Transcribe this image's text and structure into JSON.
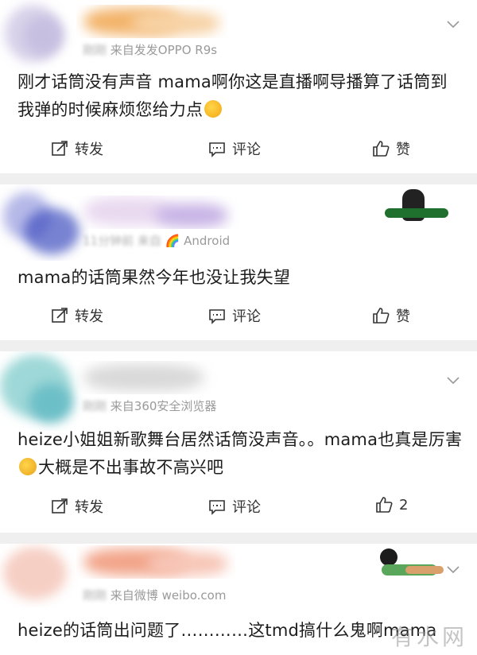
{
  "comments": [
    {
      "meta_prefix": "刚刚",
      "meta_visible": "来自发发OPPO R9s",
      "content_parts": [
        "刚才话筒没有声音  mama啊你这是直播啊导播算了话筒到我弹的时候麻烦您给力点",
        ""
      ],
      "actions": {
        "forward": "转发",
        "comment": "评论",
        "like": "赞"
      }
    },
    {
      "meta_prefix": "11分钟前",
      "meta_visible": "来自",
      "meta_visible2": "Android",
      "content_parts": [
        "mama的话筒果然今年也没让我失望"
      ],
      "actions": {
        "forward": "转发",
        "comment": "评论",
        "like": "赞"
      }
    },
    {
      "meta_prefix": "刚刚",
      "meta_visible": "来自360安全浏览器",
      "content_parts": [
        "heize小姐姐新歌舞台居然话筒没声音。。mama也真是厉害",
        "大概是不出事故不高兴吧"
      ],
      "actions": {
        "forward": "转发",
        "comment": "评论",
        "like": "2"
      }
    },
    {
      "meta_prefix": "刚刚",
      "meta_visible": "来自微博 weibo.com",
      "content_parts": [
        "heize的话筒出问题了…………这tmd搞什么鬼啊mama"
      ]
    }
  ],
  "watermark": "有水网",
  "colors": {
    "bg": "#ececec",
    "card": "#ffffff",
    "meta": "#9a9a9a"
  },
  "icons": [
    "chevron-down-icon",
    "forward-icon",
    "comment-icon",
    "like-icon",
    "emoji-icon"
  ]
}
